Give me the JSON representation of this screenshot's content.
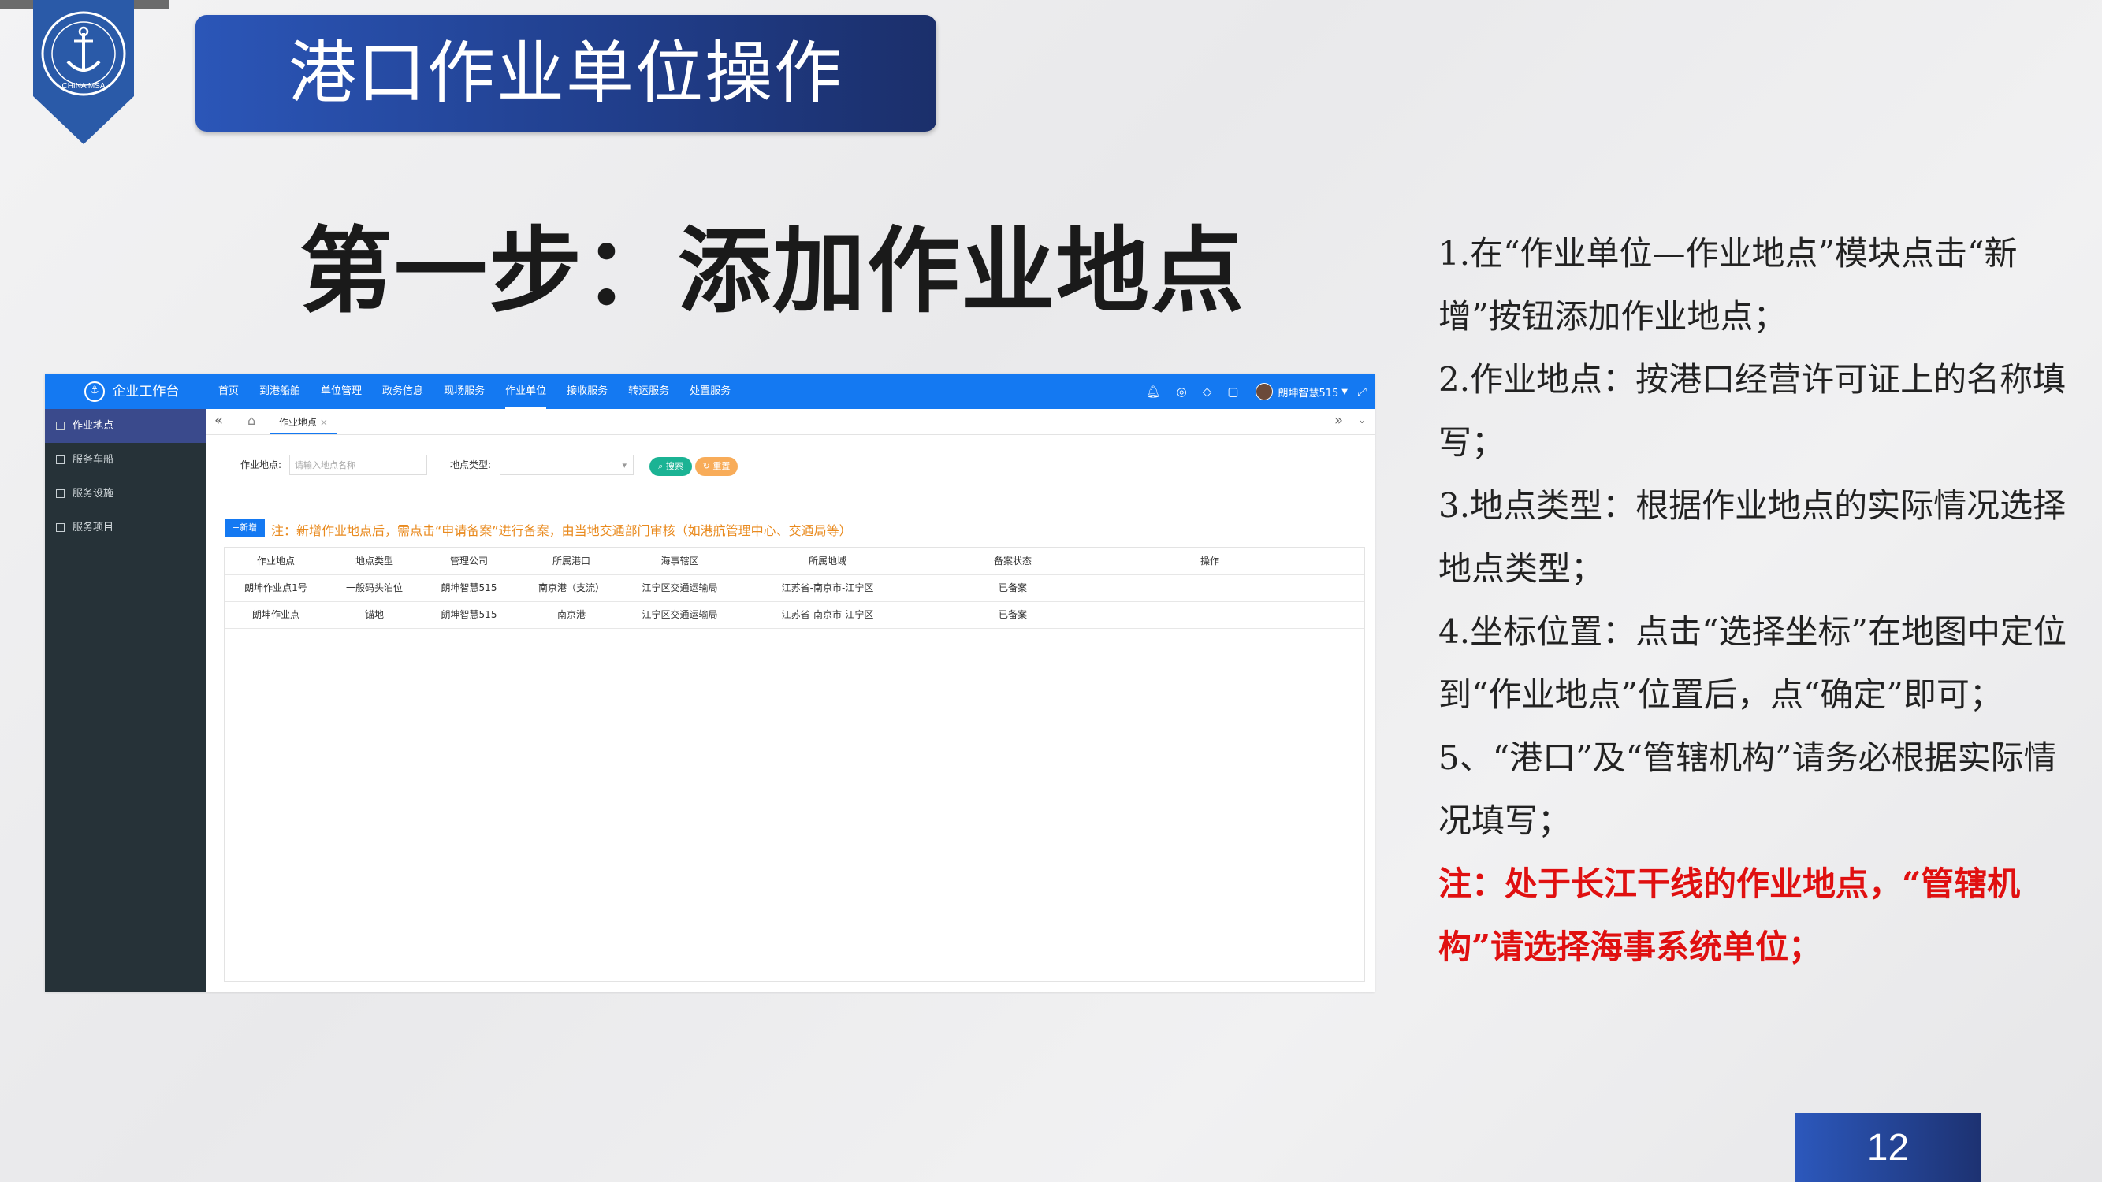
{
  "slide": {
    "title": "港口作业单位操作",
    "step_title": "第一步：添加作业地点",
    "page_number": "12",
    "emblem_text": "CHINA MSA",
    "instructions": [
      "1.在“作业单位—作业地点”模块点击“新增”按钮添加作业地点；",
      "2.作业地点：按港口经营许可证上的名称填写；",
      "3.地点类型：根据作业地点的实际情况选择地点类型；",
      "4.坐标位置：点击“选择坐标”在地图中定位到“作业地点”位置后，点“确定”即可；",
      "5、“港口”及“管辖机构”请务必根据实际情况填写；"
    ],
    "note": "注：处于长江干线的作业地点，“管辖机构”请选择海事系统单位；"
  },
  "app": {
    "logo_label": "企业工作台",
    "menu": [
      "首页",
      "到港船舶",
      "单位管理",
      "政务信息",
      "现场服务",
      "作业单位",
      "接收服务",
      "转运服务",
      "处置服务"
    ],
    "active_menu": "作业单位",
    "user_name": "朗坤智慧515",
    "sidebar": [
      "作业地点",
      "服务车船",
      "服务设施",
      "服务项目"
    ],
    "tab_label": "作业地点",
    "filter": {
      "location_label": "作业地点:",
      "location_placeholder": "请输入地点名称",
      "type_label": "地点类型:",
      "search_label": "搜索",
      "reset_label": "重置"
    },
    "add_label": "新增",
    "notice": "注：新增作业地点后，需点击“申请备案”进行备案，由当地交通部门审核（如港航管理中心、交通局等）",
    "table": {
      "columns": [
        "作业地点",
        "地点类型",
        "管理公司",
        "所属港口",
        "海事辖区",
        "所属地域",
        "备案状态",
        "操作"
      ],
      "rows": [
        [
          "朗坤作业点1号",
          "一般码头泊位",
          "朗坤智慧515",
          "南京港（支流）",
          "江宁区交通运输局",
          "江苏省-南京市-江宁区",
          "已备案",
          ""
        ],
        [
          "朗坤作业点",
          "锚地",
          "朗坤智慧515",
          "南京港",
          "江宁区交通运输局",
          "江苏省-南京市-江宁区",
          "已备案",
          ""
        ]
      ]
    }
  },
  "colors": {
    "nav_blue": "#1479f2",
    "sidebar_dark": "#263238",
    "note_red": "#e01010",
    "notice_orange": "#e98a1e"
  }
}
